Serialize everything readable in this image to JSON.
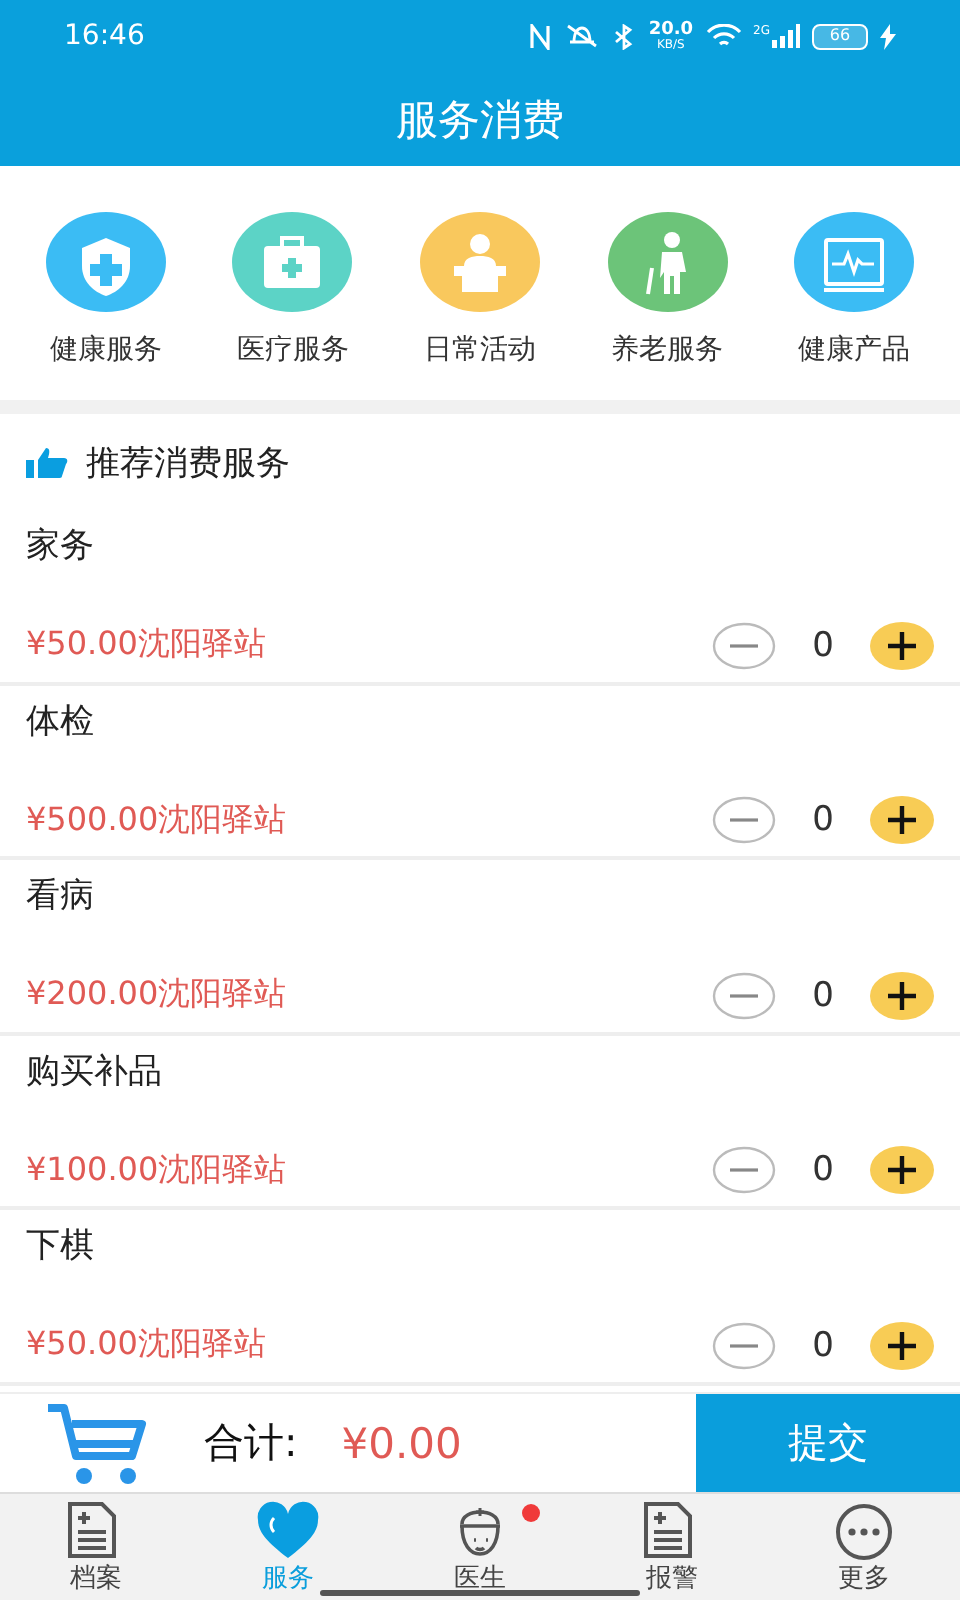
{
  "status_bar": {
    "time": "16:46",
    "speed": "20.0",
    "speed_unit": "KB/S",
    "network": "2G",
    "battery": "66"
  },
  "header": {
    "title": "服务消费"
  },
  "categories": [
    {
      "label": "健康服务",
      "kind": "shield",
      "color": "#3bbcf4"
    },
    {
      "label": "医疗服务",
      "kind": "kit",
      "color": "#5cd3c6"
    },
    {
      "label": "日常活动",
      "kind": "person",
      "color": "#f9c85d"
    },
    {
      "label": "养老服务",
      "kind": "elder",
      "color": "#6cc479"
    },
    {
      "label": "健康产品",
      "kind": "monitor",
      "color": "#3bbcf4"
    }
  ],
  "section": {
    "title": "推荐消费服务"
  },
  "items": [
    {
      "name": "家务",
      "price": "¥50.00沈阳驿站",
      "quantity": "0"
    },
    {
      "name": "体检",
      "price": "¥500.00沈阳驿站",
      "quantity": "0"
    },
    {
      "name": "看病",
      "price": "¥200.00沈阳驿站",
      "quantity": "0"
    },
    {
      "name": "购买补品",
      "price": "¥100.00沈阳驿站",
      "quantity": "0"
    },
    {
      "name": "下棋",
      "price": "¥50.00沈阳驿站",
      "quantity": "0"
    }
  ],
  "cart": {
    "total_label": "合计:",
    "total": "¥0.00",
    "submit": "提交"
  },
  "tabs": [
    {
      "label": "档案",
      "kind": "doc",
      "selected": false,
      "badge": false
    },
    {
      "label": "服务",
      "kind": "heart",
      "selected": true,
      "badge": false
    },
    {
      "label": "医生",
      "kind": "nurse",
      "selected": false,
      "badge": true
    },
    {
      "label": "报警",
      "kind": "doc",
      "selected": false,
      "badge": false
    },
    {
      "label": "更多",
      "kind": "more",
      "selected": false,
      "badge": false
    }
  ]
}
